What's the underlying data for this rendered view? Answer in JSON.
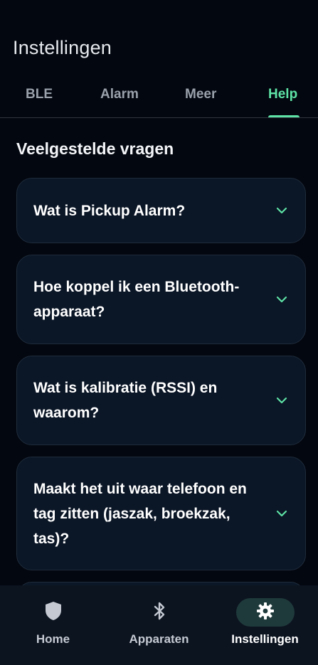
{
  "header": {
    "title": "Instellingen"
  },
  "tabs": [
    {
      "label": "BLE"
    },
    {
      "label": "Alarm"
    },
    {
      "label": "Meer"
    },
    {
      "label": "Help"
    }
  ],
  "active_tab": "Help",
  "faq": {
    "title": "Veelgestelde vragen",
    "items": [
      {
        "question": "Wat is Pickup Alarm?"
      },
      {
        "question": "Hoe koppel ik een Bluetooth-apparaat?"
      },
      {
        "question": "Wat is kalibratie (RSSI) en waarom?"
      },
      {
        "question": "Maakt het uit waar telefoon en tag zitten (jaszak, broekzak, tas)?"
      }
    ]
  },
  "bottom_nav": {
    "items": [
      {
        "label": "Home",
        "icon": "shield-icon"
      },
      {
        "label": "Apparaten",
        "icon": "bluetooth-icon"
      },
      {
        "label": "Instellingen",
        "icon": "gear-icon"
      }
    ],
    "active": "Instellingen"
  },
  "colors": {
    "background": "#03070f",
    "card": "#0b1626",
    "accent": "#5ee3a6",
    "nav_background": "#0c1420",
    "nav_active_pill": "#1f3a3b"
  }
}
